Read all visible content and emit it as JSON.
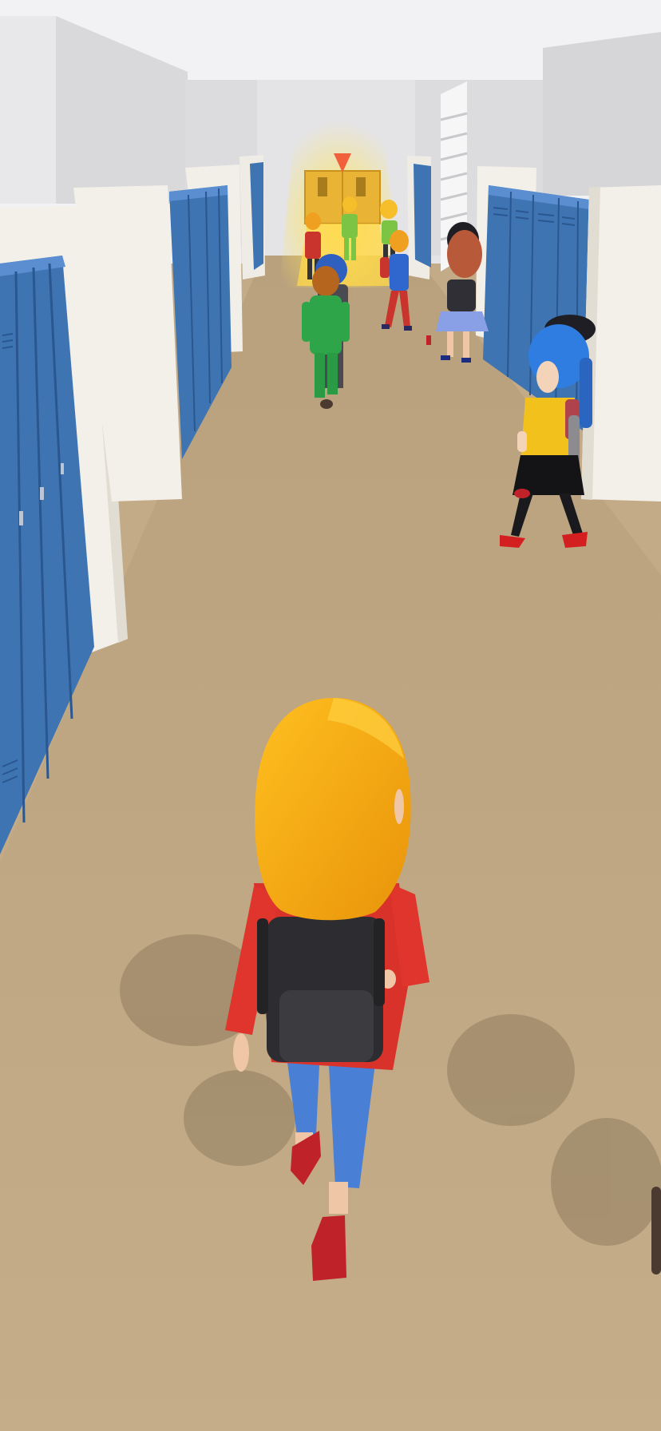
{
  "game": {
    "scene": "school-hallway-runner",
    "controls": "swipe-to-steer",
    "colors": {
      "floor": "#c4ab87",
      "ceiling": "#efeff1",
      "wall": "#e6e6e8",
      "pillar": "#f4f1ea",
      "locker": "#3f74b3",
      "locker_dark": "#2d5d97",
      "goal_glow": "#ffd84a",
      "goal_door": "#e9b436",
      "goal_marker": "#f0603d",
      "player_hair": "#f6a90d",
      "player_jacket": "#d9322a",
      "player_backpack": "#2d2d31",
      "player_pants": "#4a7fd6",
      "player_shoes": "#c0222a"
    },
    "objects": {
      "goal": {
        "label": "",
        "marker_icon": "down-triangle-marker-icon"
      },
      "npcs": [
        {
          "id": "green-suit-student"
        },
        {
          "id": "blue-hair-schoolgirl"
        },
        {
          "id": "brunette-student"
        },
        {
          "id": "red-pants-student"
        },
        {
          "id": "backpack-student"
        }
      ],
      "player": {
        "id": "player-runner-girl"
      }
    }
  }
}
